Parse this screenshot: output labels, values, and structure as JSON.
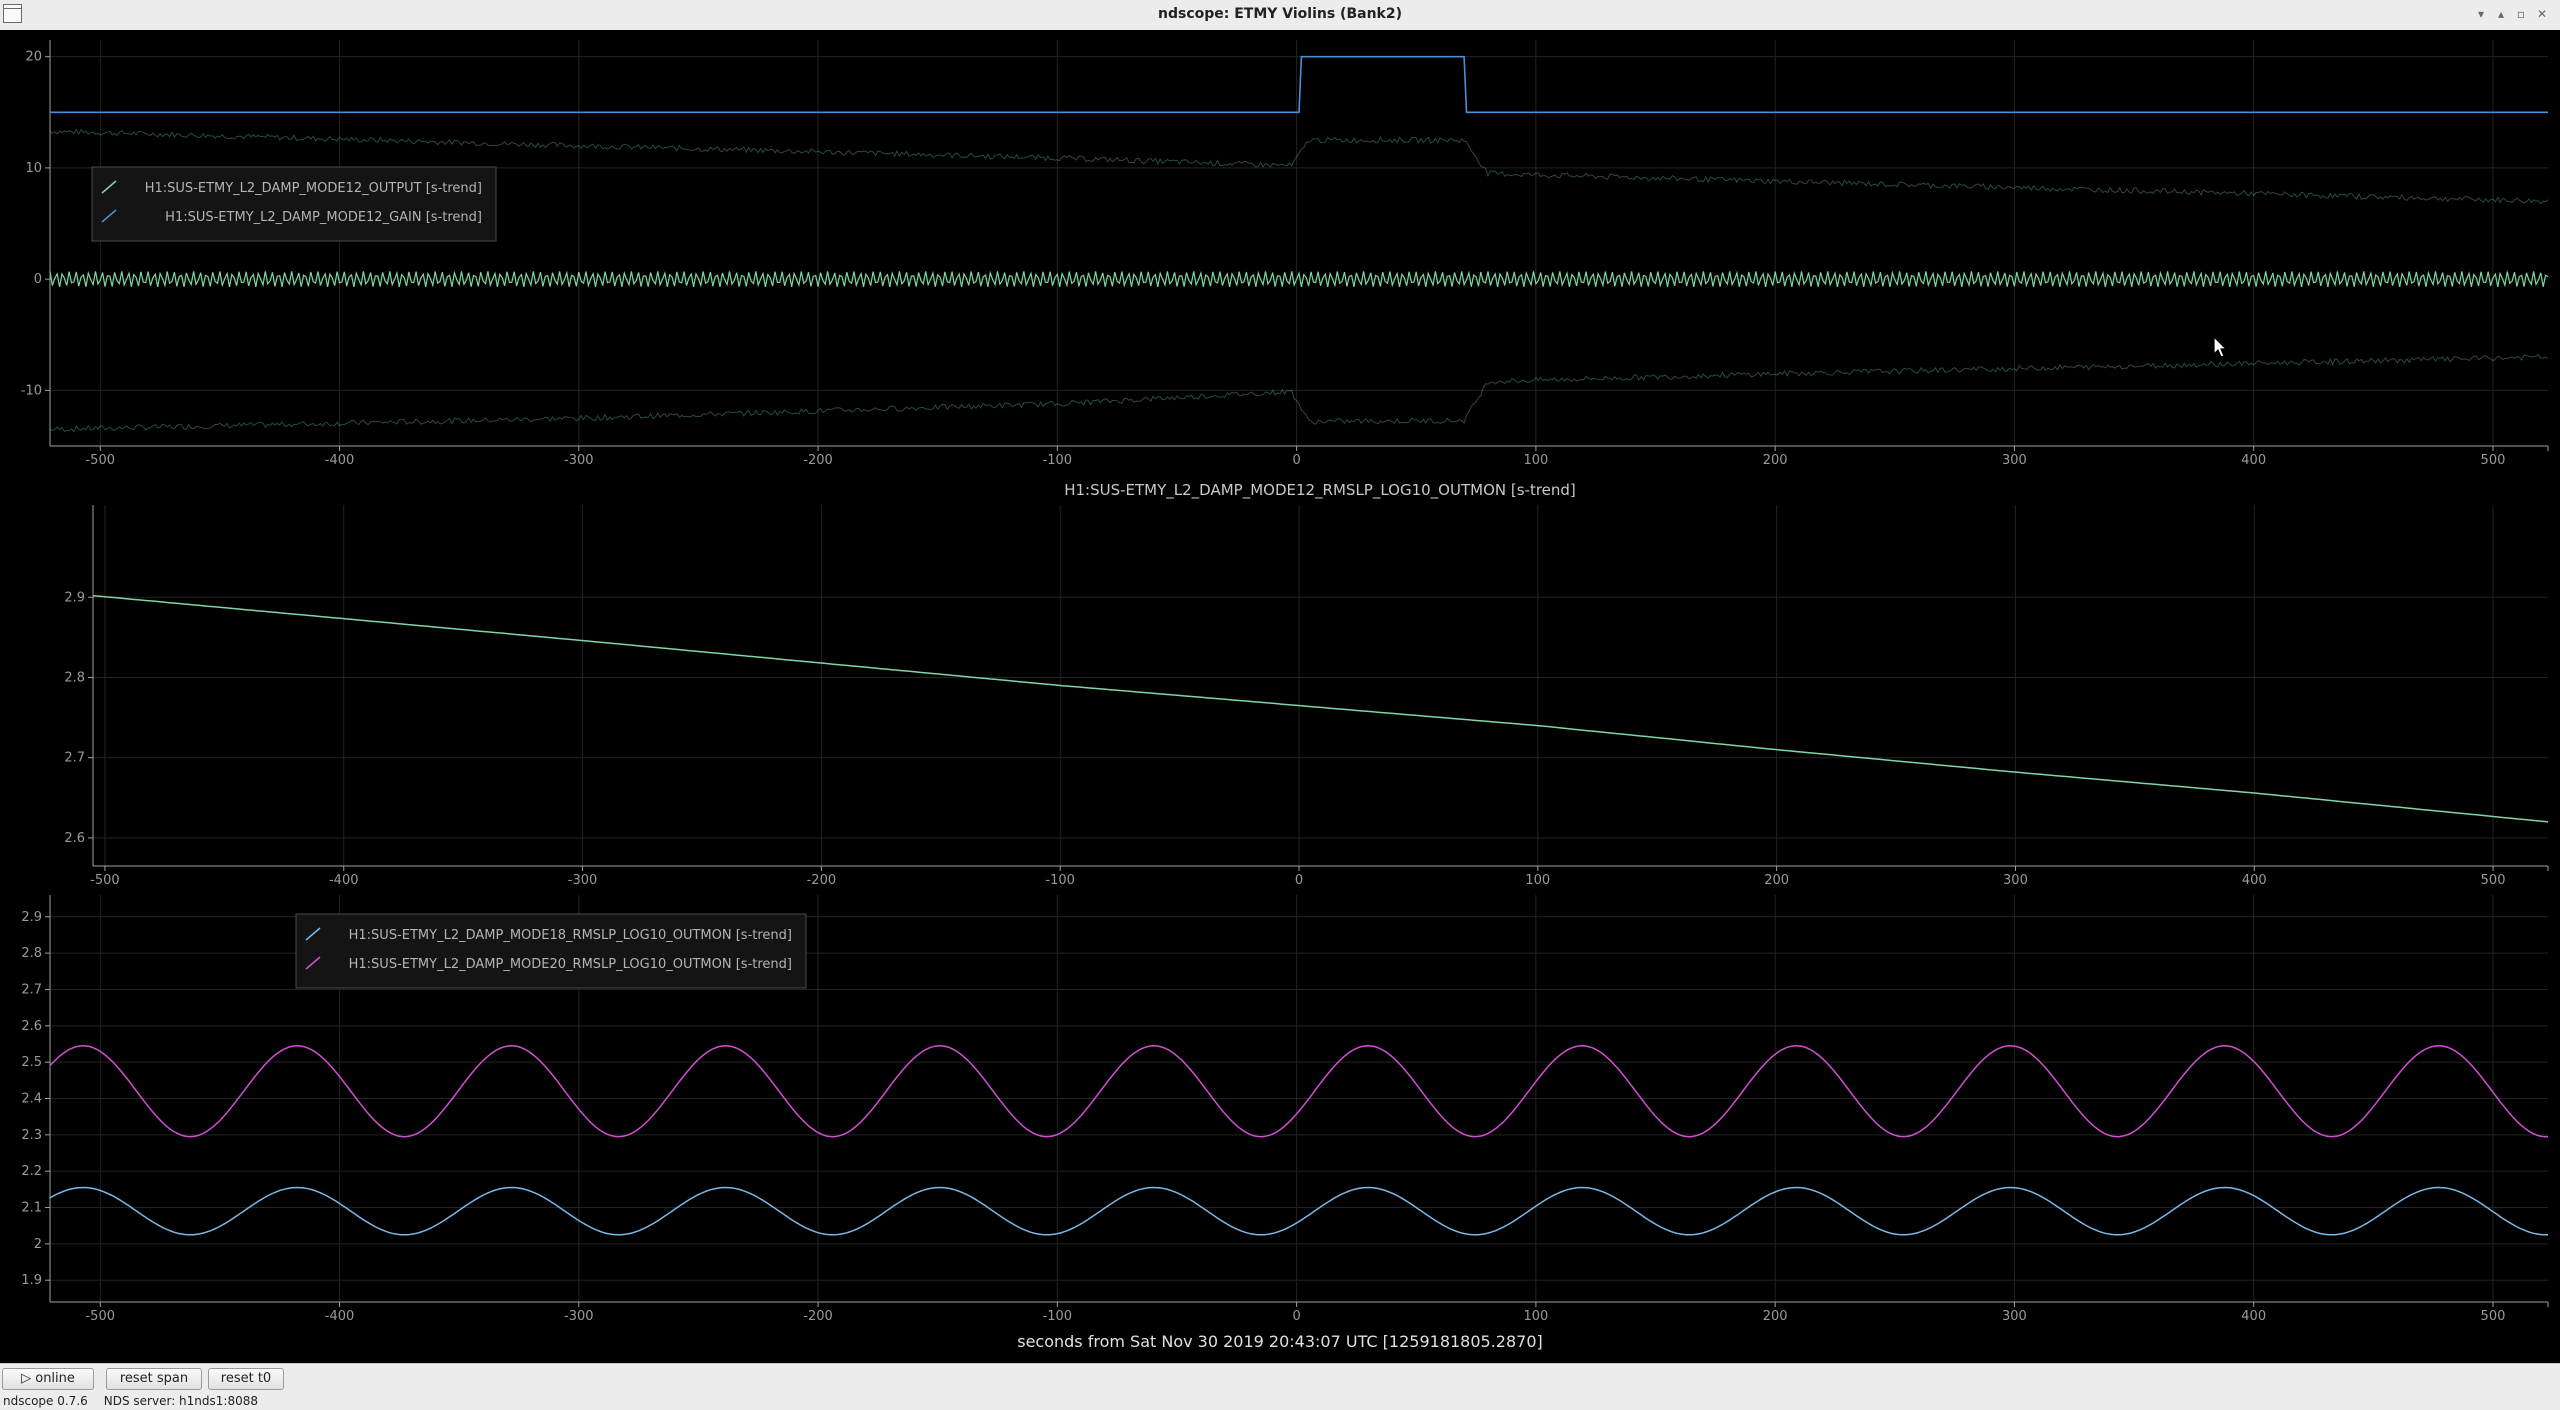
{
  "window": {
    "title": "ndscope: ETMY Violins (Bank2)",
    "buttons": [
      "▾",
      "▴",
      "▫",
      "✕"
    ]
  },
  "plots": [
    {
      "y_ticks": [
        "20",
        "10",
        "0",
        "-10"
      ],
      "x_ticks": [
        "-500",
        "-400",
        "-300",
        "-200",
        "-100",
        "0",
        "100",
        "200",
        "300",
        "400",
        "500"
      ],
      "legend": [
        {
          "label": "H1:SUS-ETMY_L2_DAMP_MODE12_OUTPUT [s-trend]",
          "color": "#7fd6a4"
        },
        {
          "label": "H1:SUS-ETMY_L2_DAMP_MODE12_GAIN [s-trend]",
          "color": "#4a8fd8"
        }
      ]
    },
    {
      "title": "H1:SUS-ETMY_L2_DAMP_MODE12_RMSLP_LOG10_OUTMON [s-trend]",
      "y_ticks": [
        "2.9",
        "2.8",
        "2.7",
        "2.6"
      ],
      "x_ticks": [
        "-500",
        "-400",
        "-300",
        "-200",
        "-100",
        "0",
        "100",
        "200",
        "300",
        "400",
        "500"
      ],
      "series_color": "#7fd6a4"
    },
    {
      "y_ticks": [
        "2.9",
        "2.8",
        "2.7",
        "2.6",
        "2.5",
        "2.4",
        "2.3",
        "2.2",
        "2.1",
        "2",
        "1.9"
      ],
      "x_ticks": [
        "-500",
        "-400",
        "-300",
        "-200",
        "-100",
        "0",
        "100",
        "200",
        "300",
        "400",
        "500"
      ],
      "legend": [
        {
          "label": "H1:SUS-ETMY_L2_DAMP_MODE18_RMSLP_LOG10_OUTMON [s-trend]",
          "color": "#7ab8e8"
        },
        {
          "label": "H1:SUS-ETMY_L2_DAMP_MODE20_RMSLP_LOG10_OUTMON [s-trend]",
          "color": "#d24fd2"
        }
      ]
    }
  ],
  "x_axis_label": "seconds from Sat Nov 30 2019 20:43:07 UTC [1259181805.2870]",
  "controls": {
    "online_label": "online",
    "reset_span_label": "reset span",
    "reset_t0_label": "reset t0"
  },
  "status": {
    "version": "ndscope 0.7.6",
    "server": "NDS server: h1nds1:8088"
  },
  "chart_data": [
    {
      "type": "line",
      "x_range": [
        -521,
        523
      ],
      "ylim": [
        -15,
        21.5
      ],
      "grid": true,
      "legend_placement": "top-left",
      "series": [
        {
          "name": "H1:SUS-ETMY_L2_DAMP_MODE12_GAIN [s-trend]",
          "x": [
            -521,
            1,
            2,
            70,
            71,
            523
          ],
          "y": [
            15,
            15,
            20,
            20,
            15,
            15
          ]
        },
        {
          "name": "H1:SUS-ETMY_L2_DAMP_MODE12_OUTPUT [s-trend]",
          "x": [
            -521,
            -300,
            -100,
            -2,
            5,
            70,
            80,
            200,
            523
          ],
          "y_max": [
            13.3,
            12.0,
            10.9,
            10.2,
            12.5,
            12.5,
            9.5,
            8.8,
            7.0
          ],
          "y_min": [
            -13.5,
            -12.5,
            -11.2,
            -10.1,
            -12.8,
            -12.7,
            -9.2,
            -8.5,
            -7.0
          ],
          "y_mean": [
            0,
            0,
            0,
            0,
            0,
            0,
            0,
            0,
            0
          ]
        }
      ]
    },
    {
      "type": "line",
      "title": "H1:SUS-ETMY_L2_DAMP_MODE12_RMSLP_LOG10_OUTMON [s-trend]",
      "x_range": [
        -505,
        523
      ],
      "ylim": [
        2.565,
        3.015
      ],
      "grid": true,
      "series": [
        {
          "name": "H1:SUS-ETMY_L2_DAMP_MODE12_RMSLP_LOG10_OUTMON [s-trend]",
          "x": [
            -505,
            -300,
            -100,
            0,
            100,
            200,
            300,
            400,
            523
          ],
          "y": [
            2.902,
            2.846,
            2.79,
            2.765,
            2.74,
            2.71,
            2.682,
            2.656,
            2.62
          ]
        }
      ]
    },
    {
      "type": "line",
      "x_range": [
        -521,
        523
      ],
      "ylim": [
        1.84,
        2.96
      ],
      "grid": true,
      "legend_placement": "top-left",
      "series": [
        {
          "name": "H1:SUS-ETMY_L2_DAMP_MODE18_RMSLP_LOG10_OUTMON [s-trend]",
          "center": 2.09,
          "amplitude": 0.065,
          "period": 89.5,
          "phase_x0": -521,
          "x_range": [
            -521,
            523
          ]
        },
        {
          "name": "H1:SUS-ETMY_L2_DAMP_MODE20_RMSLP_LOG10_OUTMON [s-trend]",
          "center": 2.42,
          "amplitude": 0.125,
          "period": 89.5,
          "phase_x0": -521,
          "x_range": [
            -521,
            523
          ]
        }
      ]
    }
  ]
}
